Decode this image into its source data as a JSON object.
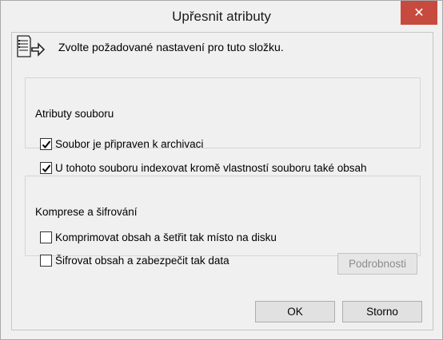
{
  "dialog": {
    "title": "Upřesnit atributy",
    "close_glyph": "✕",
    "header_text": "Zvolte požadované nastavení pro tuto složku.",
    "header_icon": "folder-properties-icon"
  },
  "file_attributes": {
    "legend": "Atributy souboru",
    "archive": {
      "label": "Soubor je připraven k archivaci",
      "checked": true
    },
    "index": {
      "label": "U tohoto souboru indexovat kromě vlastností souboru také obsah",
      "checked": true
    }
  },
  "compress_encrypt": {
    "legend": "Komprese a šifrování",
    "compress": {
      "label": "Komprimovat obsah a šetřit tak místo na disku",
      "checked": false
    },
    "encrypt": {
      "label": "Šifrovat obsah a zabezpečit tak data",
      "checked": false
    },
    "details_label": "Podrobnosti"
  },
  "buttons": {
    "ok_label": "OK",
    "cancel_label": "Storno"
  },
  "colors": {
    "close_button": "#c74a3e",
    "dialog_bg": "#f0f0f0"
  }
}
